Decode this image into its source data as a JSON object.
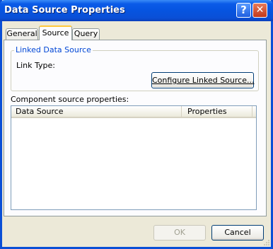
{
  "window": {
    "title": "Data Source Properties"
  },
  "titlebar_buttons": {
    "help": "?",
    "close": "✕"
  },
  "tabs": [
    {
      "label": "General",
      "selected": false
    },
    {
      "label": "Source",
      "selected": true
    },
    {
      "label": "Query",
      "selected": false
    }
  ],
  "linked_group": {
    "legend": "Linked Data Source",
    "link_type_label": "Link Type:",
    "configure_button": "Configure Linked Source..."
  },
  "component": {
    "label": "Component source properties:",
    "columns": [
      "Data Source",
      "Properties"
    ],
    "rows": []
  },
  "buttons": {
    "ok": "OK",
    "cancel": "Cancel"
  },
  "colors": {
    "accent": "#0a4fd6",
    "legend": "#0046d5",
    "selected_tab_highlight": "#ffc83c"
  }
}
